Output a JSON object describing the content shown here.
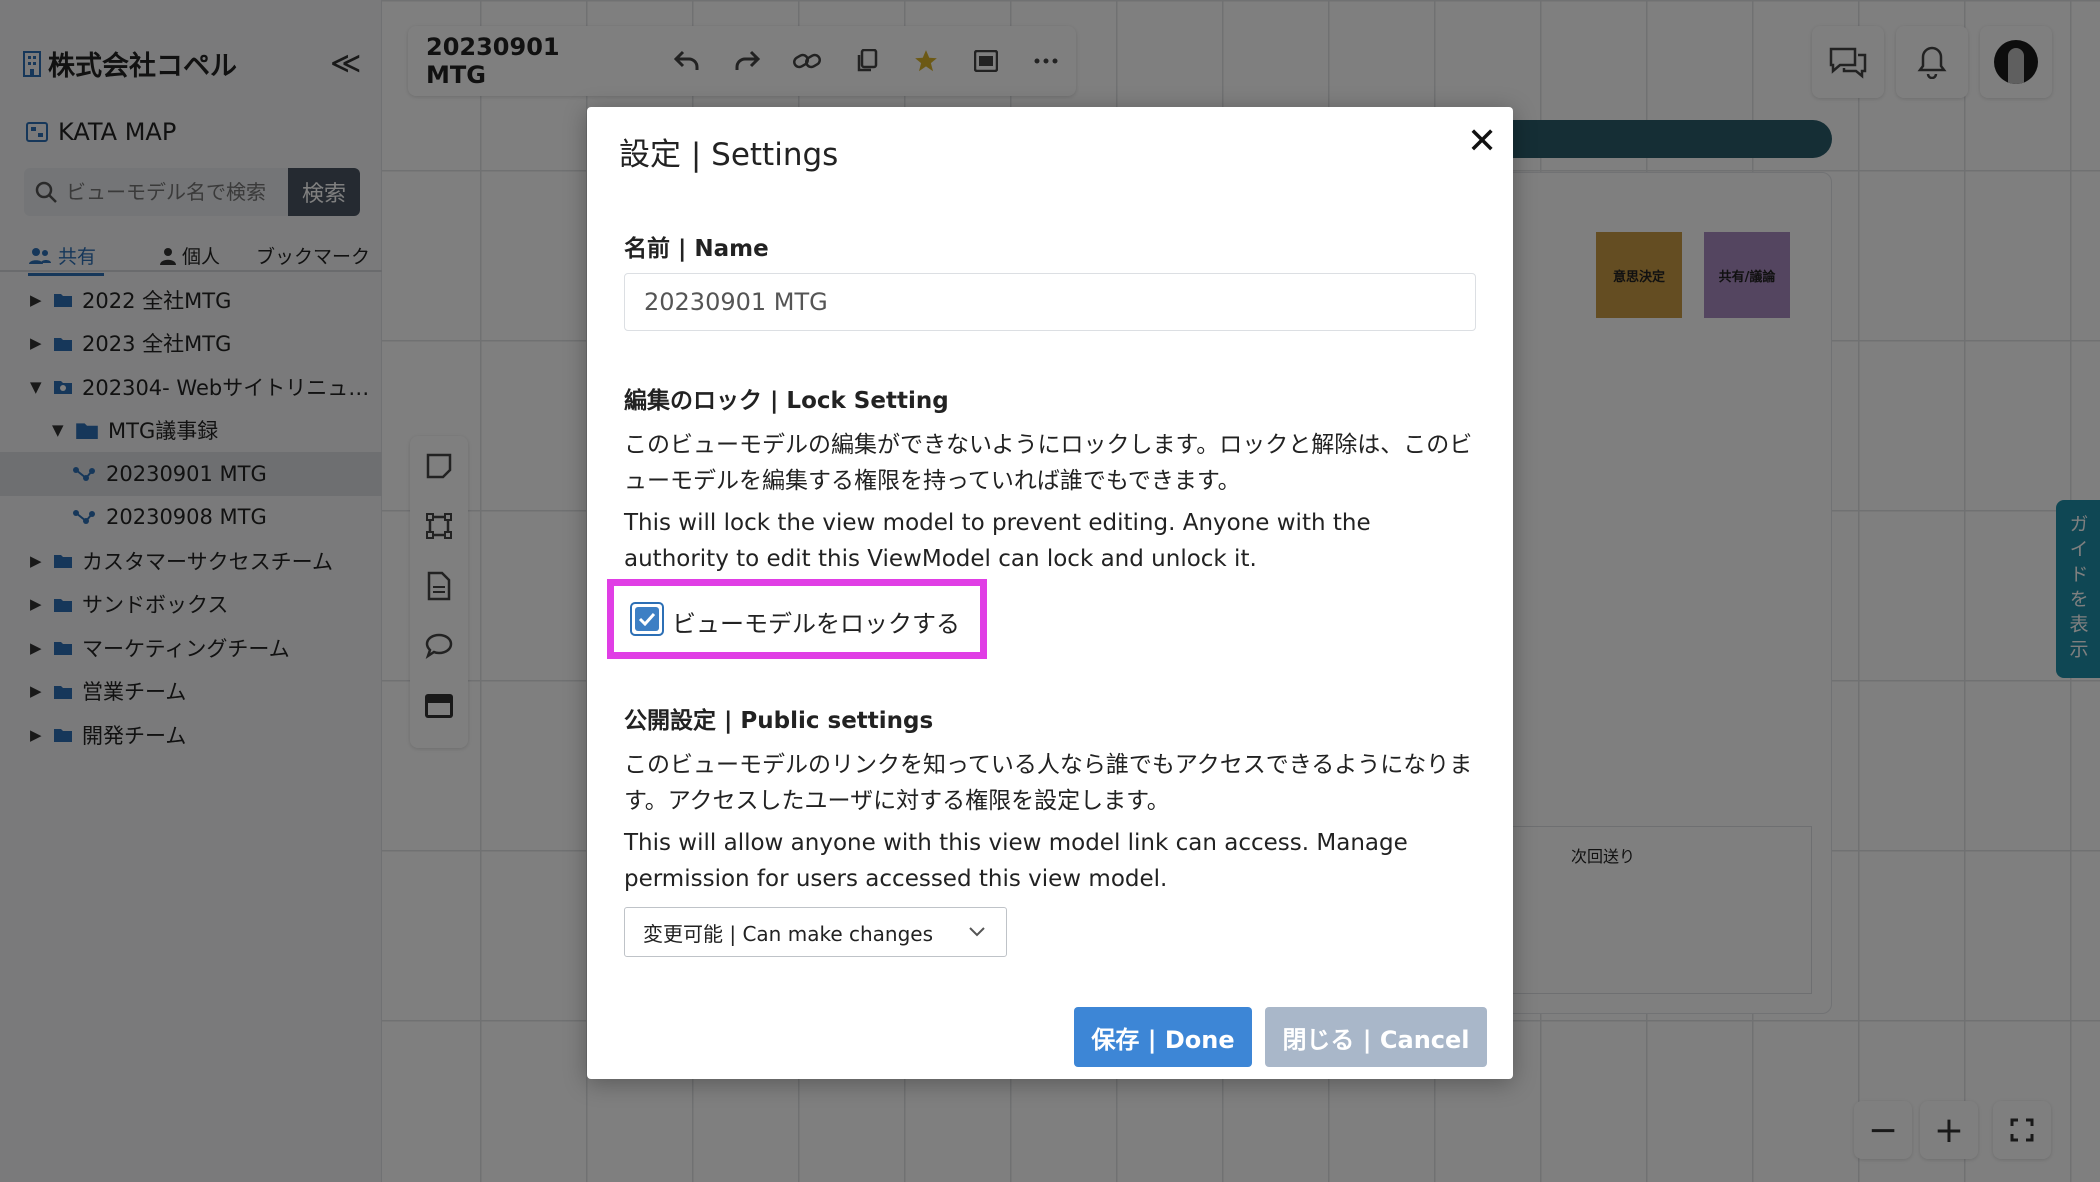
{
  "sidebar": {
    "company": "株式会社コペル",
    "collapse_icon": "≪",
    "kata_map": "KATA MAP",
    "search_placeholder": "ビューモデル名で検索",
    "search_button": "検索",
    "tabs": [
      {
        "label": "共有",
        "icon": "users-icon",
        "active": true
      },
      {
        "label": "個人",
        "icon": "user-icon",
        "active": false
      },
      {
        "label": "ブックマーク",
        "icon": "",
        "active": false
      }
    ],
    "tree": [
      {
        "label": "2022 全社MTG",
        "level": 0,
        "type": "folder",
        "expanded": false
      },
      {
        "label": "2023 全社MTG",
        "level": 0,
        "type": "folder",
        "expanded": false
      },
      {
        "label": "202304- Webサイトリニュ…",
        "level": 0,
        "type": "folder",
        "expanded": true
      },
      {
        "label": "MTG議事録",
        "level": 1,
        "type": "folder",
        "expanded": true
      },
      {
        "label": "20230901 MTG",
        "level": 2,
        "type": "viewmodel",
        "selected": true
      },
      {
        "label": "20230908 MTG",
        "level": 2,
        "type": "viewmodel",
        "selected": false
      },
      {
        "label": "カスタマーサクセスチーム",
        "level": 0,
        "type": "folder",
        "expanded": false
      },
      {
        "label": "サンドボックス",
        "level": 0,
        "type": "folder",
        "expanded": false
      },
      {
        "label": "マーケティングチーム",
        "level": 0,
        "type": "folder",
        "expanded": false
      },
      {
        "label": "営業チーム",
        "level": 0,
        "type": "folder",
        "expanded": false
      },
      {
        "label": "開発チーム",
        "level": 0,
        "type": "folder",
        "expanded": false
      }
    ]
  },
  "toolbar": {
    "title": "20230901 MTG",
    "icons": [
      "undo-icon",
      "redo-icon",
      "link-icon",
      "copy-icon",
      "star-icon",
      "image-icon",
      "more-icon"
    ]
  },
  "canvas": {
    "sticky_notes": [
      {
        "label": "意思決定",
        "color": "#c89a45"
      },
      {
        "label": "共有/議論",
        "color": "#a98bc0"
      }
    ],
    "next_box_label": "次回送り",
    "guide_label": "ガイドを表示",
    "zoom_out": "−",
    "zoom_in": "+"
  },
  "modal": {
    "title": "設定 | Settings",
    "close": "✕",
    "name_label": "名前 | Name",
    "name_value": "20230901 MTG",
    "lock_label": "編集のロック | Lock Setting",
    "lock_desc_ja": "このビューモデルの編集ができないようにロックします。ロックと解除は、このビューモデルを編集する権限を持っていれば誰でもできます。",
    "lock_desc_en": "This will lock the view model to prevent editing. Anyone with the authority to edit this ViewModel can lock and unlock it.",
    "lock_checkbox_label": "ビューモデルをロックする",
    "lock_checked": true,
    "public_label": "公開設定 | Public settings",
    "public_desc_ja": "このビューモデルのリンクを知っている人なら誰でもアクセスできるようになります。アクセスしたユーザに対する権限を設定します。",
    "public_desc_en": "This will allow anyone with this view model link can access. Manage permission for users accessed this view model.",
    "permission_selected": "変更可能 | Can make changes",
    "done_button": "保存 | Done",
    "cancel_button": "閉じる | Cancel"
  },
  "colors": {
    "accent": "#3d86d6",
    "highlight": "#e03ee5",
    "cancel": "#a9b7c9"
  }
}
